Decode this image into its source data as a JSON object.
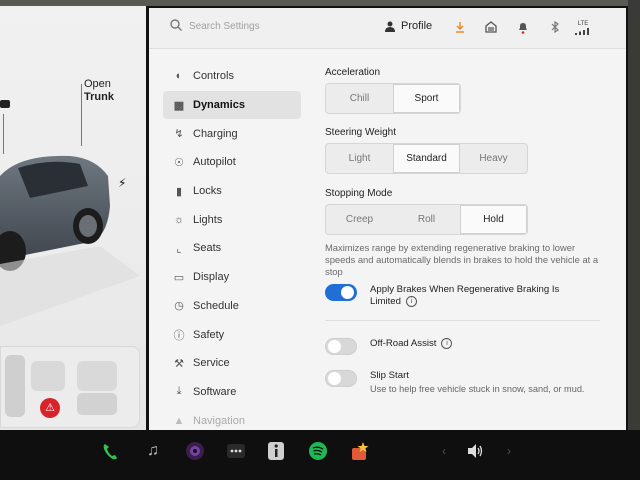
{
  "car_panel": {
    "trunk_label_top": "Open",
    "trunk_label_bottom": "Trunk"
  },
  "topbar": {
    "search_placeholder": "Search Settings",
    "profile_label": "Profile",
    "lte_label": "LTE"
  },
  "menu": {
    "items": [
      {
        "label": "Controls",
        "icon": "toggle-icon"
      },
      {
        "label": "Dynamics",
        "icon": "car-icon"
      },
      {
        "label": "Charging",
        "icon": "bolt-icon"
      },
      {
        "label": "Autopilot",
        "icon": "steering-wheel-icon"
      },
      {
        "label": "Locks",
        "icon": "lock-icon"
      },
      {
        "label": "Lights",
        "icon": "sun-icon"
      },
      {
        "label": "Seats",
        "icon": "seat-icon"
      },
      {
        "label": "Display",
        "icon": "display-icon"
      },
      {
        "label": "Schedule",
        "icon": "alarm-clock-icon"
      },
      {
        "label": "Safety",
        "icon": "alert-circle-icon"
      },
      {
        "label": "Service",
        "icon": "wrench-icon"
      },
      {
        "label": "Software",
        "icon": "download-icon"
      },
      {
        "label": "Navigation",
        "icon": "navigation-arrow-icon"
      }
    ],
    "active": "Dynamics"
  },
  "acceleration": {
    "label": "Acceleration",
    "options": [
      "Chill",
      "Sport"
    ],
    "selected": "Sport"
  },
  "steering": {
    "label": "Steering Weight",
    "options": [
      "Light",
      "Standard",
      "Heavy"
    ],
    "selected": "Standard"
  },
  "stopping": {
    "label": "Stopping Mode",
    "options": [
      "Creep",
      "Roll",
      "Hold"
    ],
    "selected": "Hold",
    "description": "Maximizes range by extending regenerative braking to lower speeds and automatically blends in brakes to hold the vehicle at a stop"
  },
  "apply_brakes": {
    "label": "Apply Brakes When Regenerative Braking Is Limited",
    "state": "on"
  },
  "off_road": {
    "label": "Off-Road Assist",
    "state": "off"
  },
  "slip_start": {
    "label": "Slip Start",
    "description": "Use to help free vehicle stuck in snow, sand, or mud.",
    "state": "off"
  },
  "colors": {
    "toggle_on": "#1f6fd6",
    "phone_green": "#2ec44b",
    "spotify_green": "#1db954",
    "alert_red": "#d8232a",
    "download_orange": "#f08a24"
  },
  "dock": {
    "items": [
      "phone-icon",
      "music-note-icon",
      "camera-icon",
      "more-dots-icon",
      "info-icon",
      "spotify-icon",
      "games-icon",
      "left-chevron-icon",
      "volume-icon",
      "right-chevron-icon"
    ]
  }
}
